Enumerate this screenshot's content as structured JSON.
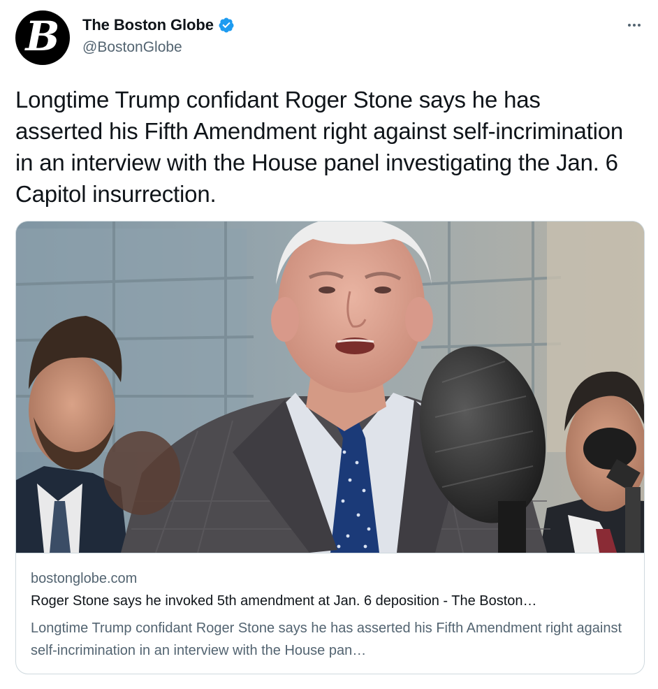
{
  "author": {
    "display_name": "The Boston Globe",
    "handle": "@BostonGlobe",
    "avatar_icon": "boston-globe-logo",
    "avatar_letter": "B",
    "verified": true
  },
  "tweet": {
    "text": "Longtime Trump confidant Roger Stone says he has asserted his Fifth Amendment right against self-incrimination in an interview with the House panel investigating the Jan. 6 Capitol insurrection."
  },
  "card": {
    "image_icon": "news-photo",
    "domain": "bostonglobe.com",
    "title": "Roger Stone says he invoked 5th amendment at Jan. 6 deposition - The Boston…",
    "description": "Longtime Trump confidant Roger Stone says he has asserted his Fifth Amendment right against self-incrimination in an interview with the House pan…"
  },
  "colors": {
    "text_primary": "#0f1419",
    "text_secondary": "#536471",
    "verified_blue": "#1d9bf0",
    "border": "#cfd9de"
  },
  "icons": {
    "more": "more-horizontal-icon",
    "verified": "verified-badge-icon"
  }
}
